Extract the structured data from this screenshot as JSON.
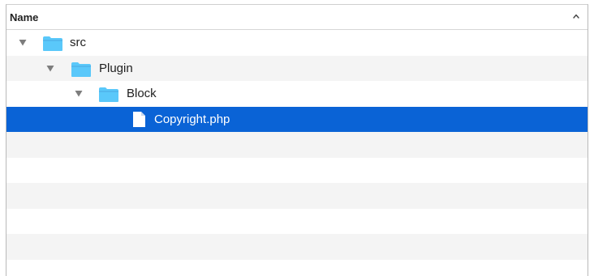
{
  "header": {
    "name_column": "Name",
    "sort_icon": "chevron-up-icon"
  },
  "tree": [
    {
      "label": "src",
      "kind": "folder",
      "depth": 0,
      "expanded": true,
      "selected": false
    },
    {
      "label": "Plugin",
      "kind": "folder",
      "depth": 1,
      "expanded": true,
      "selected": false
    },
    {
      "label": "Block",
      "kind": "folder",
      "depth": 2,
      "expanded": true,
      "selected": false
    },
    {
      "label": "Copyright.php",
      "kind": "file",
      "depth": 3,
      "expanded": false,
      "selected": true
    }
  ],
  "colors": {
    "selection": "#0a63d6",
    "folder": "#5ac8fa",
    "alternate_row": "#f4f4f4"
  }
}
